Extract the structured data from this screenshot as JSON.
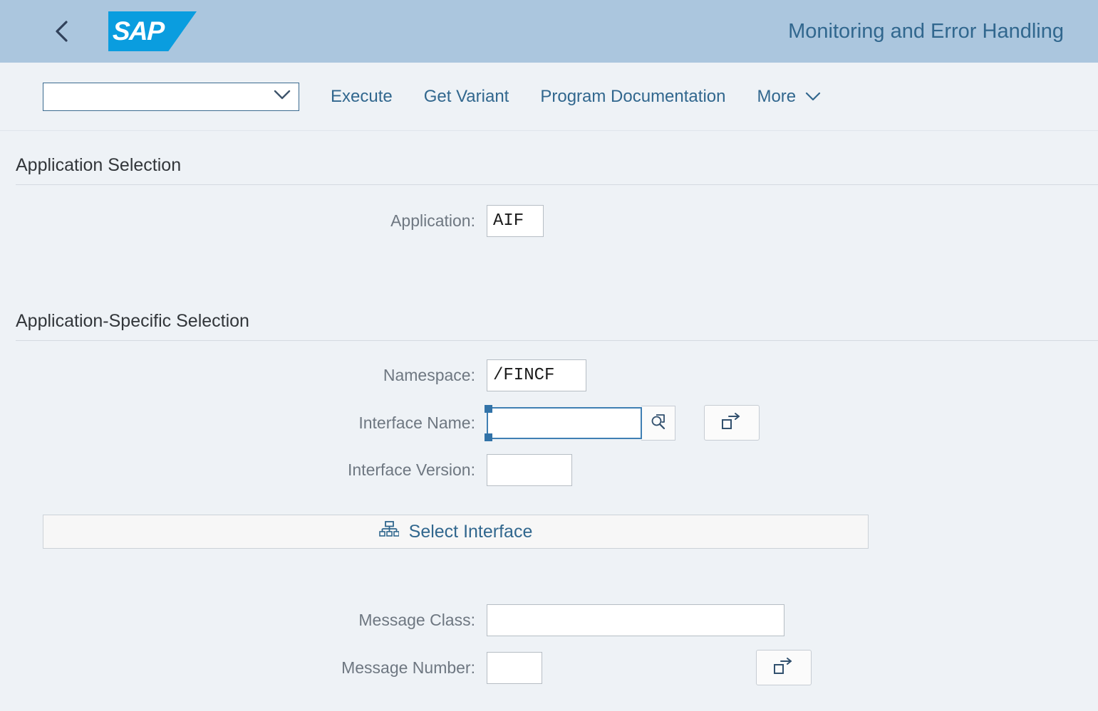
{
  "header": {
    "title": "Monitoring and Error Handling",
    "back_icon": "chevron-left-icon",
    "logo_text": "SAP",
    "bg_color": "#abc6de",
    "logo_color": "#0a9ddf",
    "title_color": "#31678e"
  },
  "toolbar": {
    "variant": {
      "value": "",
      "placeholder": "",
      "chevron_icon": "chevron-down-icon"
    },
    "execute_label": "Execute",
    "get_variant_label": "Get Variant",
    "program_documentation_label": "Program Documentation",
    "more_label": "More",
    "more_icon": "chevron-down-icon"
  },
  "application_selection": {
    "section_title": "Application Selection",
    "application_label": "Application:",
    "application_value": "AIF"
  },
  "application_specific_selection": {
    "section_title": "Application-Specific Selection",
    "namespace_label": "Namespace:",
    "namespace_value": "/FINCF",
    "interface_name_label": "Interface Name:",
    "interface_name_value": "",
    "interface_name_value_help_icon": "value-help-search-icon",
    "interface_name_multi_select_icon": "multi-selection-arrow-icon",
    "interface_version_label": "Interface Version:",
    "interface_version_value": "",
    "select_interface_label": "Select Interface",
    "select_interface_icon": "hierarchy-icon",
    "message_class_label": "Message Class:",
    "message_class_value": "",
    "message_number_label": "Message Number:",
    "message_number_value": "",
    "message_number_multi_select_icon": "multi-selection-arrow-icon"
  }
}
